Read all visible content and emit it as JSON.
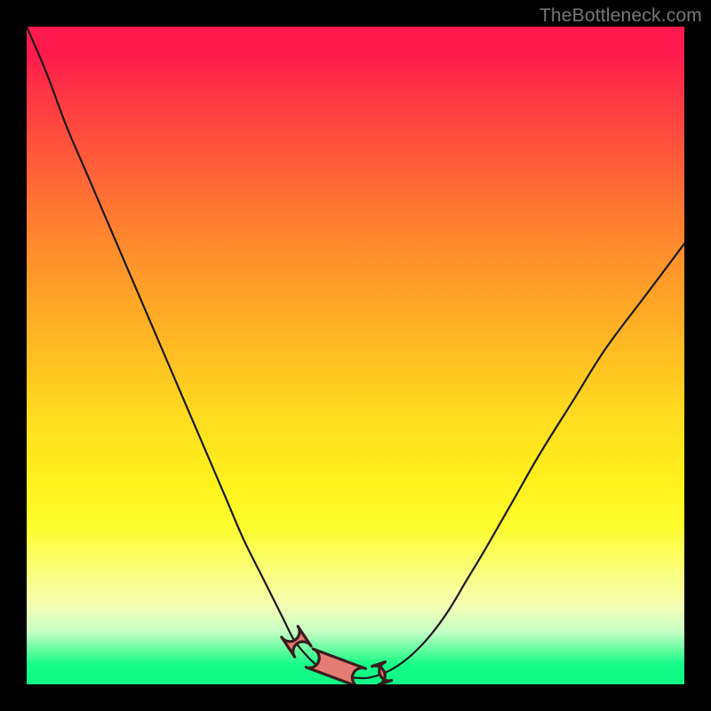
{
  "watermark": "TheBottleneck.com",
  "colors": {
    "sausage_fill": "#e57c73",
    "sausage_stroke": "#3a1d1d",
    "curve_stroke": "#1a1a1a"
  },
  "chart_data": {
    "type": "line",
    "title": "",
    "xlabel": "",
    "ylabel": "",
    "xlim": [
      0,
      100
    ],
    "ylim": [
      0,
      100
    ],
    "grid": false,
    "legend": false,
    "series": [
      {
        "name": "curve",
        "x": [
          0,
          3,
          6,
          9,
          12,
          15,
          18,
          21,
          24,
          27,
          30,
          33,
          36,
          39,
          40.5,
          42,
          44,
          46,
          48,
          50,
          52,
          55,
          58,
          61,
          64,
          67,
          70,
          74,
          78,
          83,
          88,
          94,
          100
        ],
        "y": [
          100,
          93,
          85,
          78,
          71,
          64,
          57,
          50,
          43,
          36,
          29,
          22,
          16,
          10,
          7,
          5,
          3,
          2,
          1,
          1,
          1,
          2,
          4,
          7,
          11,
          16,
          21,
          28,
          35,
          43,
          51,
          59,
          67
        ],
        "note": "y is the vertical position from the bottom of the gradient panel (0 = bottom/green, 100 = top/red). Approximate V-shape with steep left branch and gentler right branch; minimum near x≈48."
      }
    ],
    "annotations": [
      {
        "name": "coral-segments",
        "description": "Three short thick coral-colored capsule segments along the curve near the minimum",
        "segments_x": [
          [
            40,
            42
          ],
          [
            43,
            51
          ],
          [
            53,
            55
          ]
        ]
      }
    ]
  }
}
